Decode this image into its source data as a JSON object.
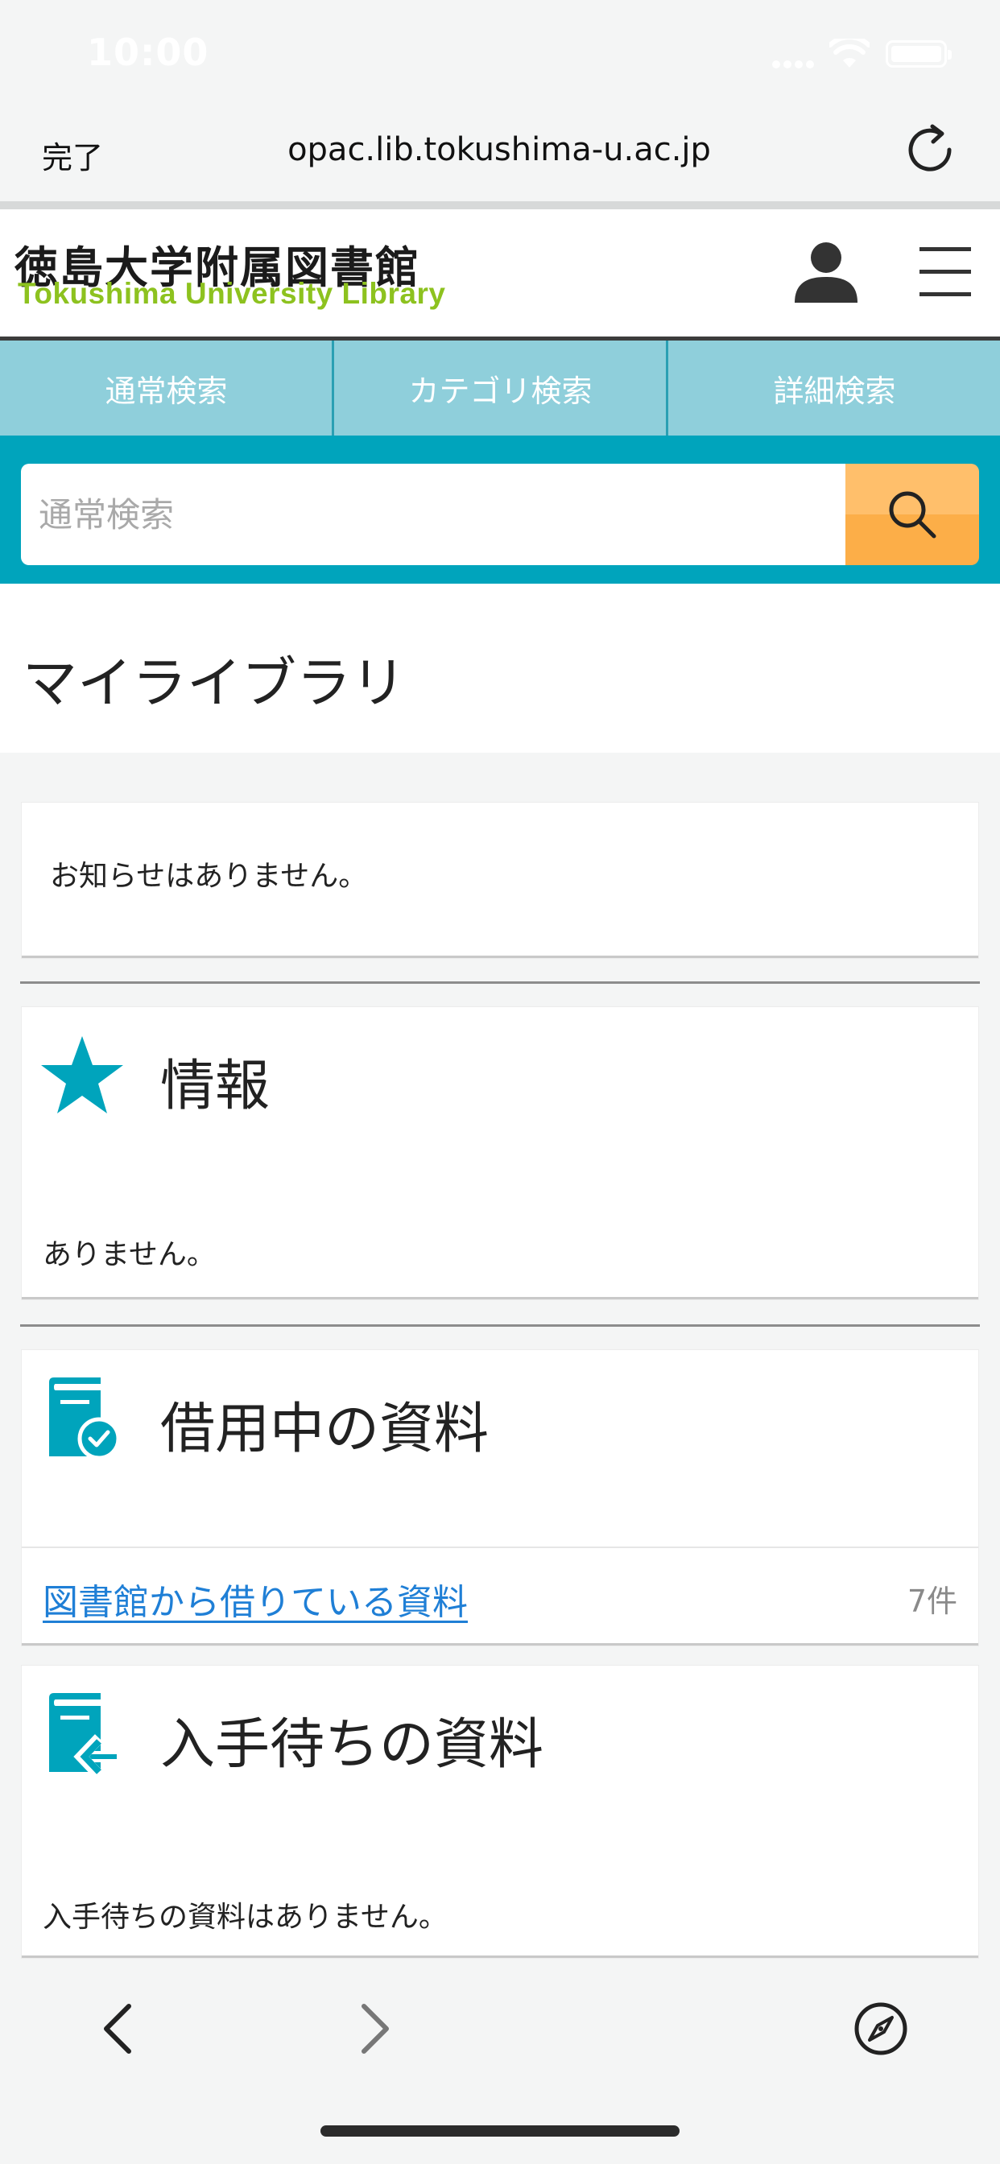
{
  "status": {
    "time": "10:00"
  },
  "browser": {
    "done_label": "完了",
    "url": "opac.lib.tokushima-u.ac.jp"
  },
  "header": {
    "logo_jp": "徳島大学附属図書館",
    "logo_en": "Tokushima University Library"
  },
  "tabs": [
    {
      "label": "通常検索"
    },
    {
      "label": "カテゴリ検索"
    },
    {
      "label": "詳細検索"
    }
  ],
  "search": {
    "placeholder": "通常検索"
  },
  "page": {
    "title": "マイライブラリ"
  },
  "notice": {
    "text": "お知らせはありません。"
  },
  "info": {
    "heading": "情報",
    "text": "ありません。"
  },
  "borrowed": {
    "heading": "借用中の資料",
    "link_label": "図書館から借りている資料",
    "count": "7件"
  },
  "waiting": {
    "heading": "入手待ちの資料",
    "text": "入手待ちの資料はありません。"
  },
  "colors": {
    "accent": "#00a4bc",
    "tab_bg": "#8fcfdb",
    "search_button": "#fcae48",
    "logo_green": "#8dc21f",
    "link": "#1f7fd6"
  },
  "icons": [
    "reload-icon",
    "account-icon",
    "menu-icon",
    "search-icon",
    "star-icon",
    "book-check-icon",
    "book-return-icon",
    "back-arrow-icon",
    "forward-arrow-icon",
    "compass-icon"
  ]
}
